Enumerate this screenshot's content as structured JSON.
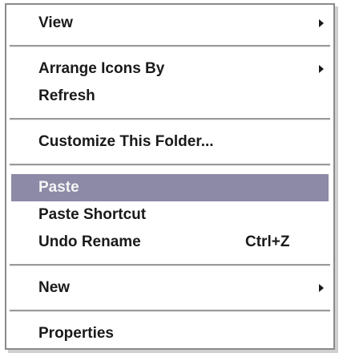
{
  "menu": {
    "items": [
      {
        "label": "View",
        "has_submenu": true
      },
      {
        "label": "Arrange Icons By",
        "has_submenu": true
      },
      {
        "label": "Refresh"
      },
      {
        "label": "Customize This Folder..."
      },
      {
        "label": "Paste",
        "highlighted": true
      },
      {
        "label": "Paste Shortcut"
      },
      {
        "label": "Undo Rename",
        "shortcut": "Ctrl+Z"
      },
      {
        "label": "New",
        "has_submenu": true
      },
      {
        "label": "Properties"
      }
    ]
  },
  "colors": {
    "highlight": "#8c8aa6",
    "separator": "#9a9a9a",
    "text": "#1a1a1a"
  },
  "icons": {
    "submenu": "submenu-arrow-icon"
  }
}
